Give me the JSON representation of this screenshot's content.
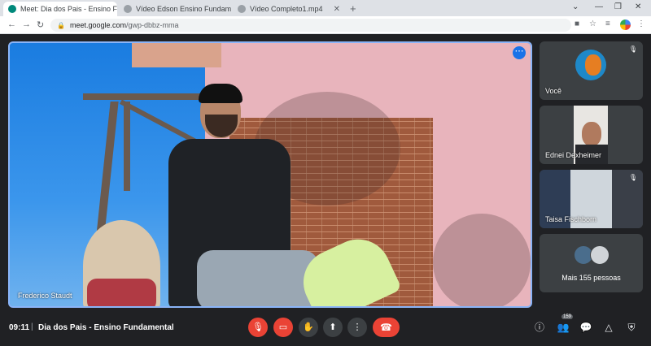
{
  "tabs": [
    {
      "label": "Meet: Dia dos Pais - Ensino F",
      "active": true,
      "favicon_color": "#00897b"
    },
    {
      "label": "Vídeo Edson Ensino Fundamental",
      "active": false,
      "favicon_color": "#9aa0a6"
    },
    {
      "label": "Vídeo Completo1.mp4",
      "active": false,
      "favicon_color": "#9aa0a6"
    }
  ],
  "new_tab_label": "+",
  "url": {
    "host": "meet.google.com",
    "path": "/gwp-dbbz-mma"
  },
  "main_video": {
    "speaker_name": "Frederico Staudt"
  },
  "tiles": [
    {
      "name": "Você",
      "muted": true
    },
    {
      "name": "Ednei Dexheimer",
      "muted": false
    },
    {
      "name": "Taisa Fischborn",
      "muted": true
    },
    {
      "name": "Mais 155 pessoas",
      "muted": false
    }
  ],
  "bottom_bar": {
    "time": "09:11",
    "separator": "|",
    "meeting_title": "Dia dos Pais - Ensino Fundamental",
    "participants_badge": "159"
  },
  "icons": {
    "mic_off": "mic-off-icon",
    "cam_off": "camera-off-icon",
    "raise_hand": "hand-icon",
    "present": "present-icon",
    "more": "more-vert-icon",
    "hangup": "call-end-icon",
    "info": "info-icon",
    "people": "people-icon",
    "chat": "chat-icon",
    "activities": "shapes-icon",
    "host_controls": "shield-icon"
  },
  "colors": {
    "accent": "#1a73e8",
    "danger": "#ea4335",
    "frame": "#8ab4f8",
    "bg": "#202124"
  }
}
